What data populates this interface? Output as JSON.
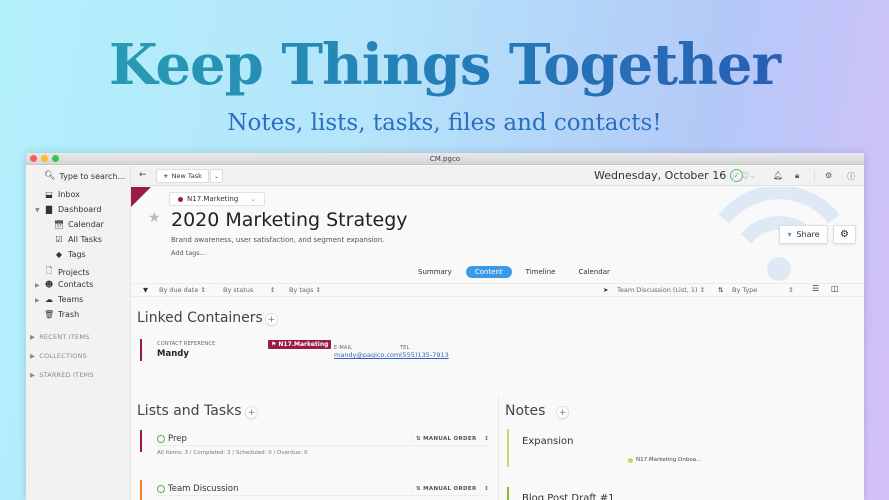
{
  "hero": {
    "title": "Keep Things Together",
    "subtitle": "Notes, lists, tasks, files and contacts!"
  },
  "window": {
    "title": "CM.pgco"
  },
  "sidebar": {
    "search_placeholder": "Type to search...",
    "items": [
      {
        "label": "Inbox",
        "icon": "inbox-icon"
      },
      {
        "label": "Dashboard",
        "icon": "chart-icon"
      },
      {
        "label": "Calendar",
        "icon": "calendar-icon"
      },
      {
        "label": "All Tasks",
        "icon": "checkbox-icon"
      },
      {
        "label": "Tags",
        "icon": "tags-icon"
      },
      {
        "label": "Projects",
        "icon": "document-icon"
      },
      {
        "label": "Contacts",
        "icon": "person-icon"
      },
      {
        "label": "Teams",
        "icon": "cloud-icon"
      },
      {
        "label": "Trash",
        "icon": "trash-icon"
      }
    ],
    "sections": [
      "RECENT ITEMS",
      "COLLECTIONS",
      "STARRED ITEMS"
    ]
  },
  "toolbar": {
    "back": "←",
    "new_task_label": "New Task",
    "date": "Wednesday, October 16"
  },
  "page": {
    "container": "N17.Marketing",
    "container_color": "#9a1b46",
    "title": "2020 Marketing Strategy",
    "description": "Brand awareness, user satisfaction, and segment expansion.",
    "add_tags": "Add tags...",
    "share_label": "Share",
    "tabs": [
      {
        "label": "Summary",
        "active": false
      },
      {
        "label": "Content",
        "active": true
      },
      {
        "label": "Timeline",
        "active": false
      },
      {
        "label": "Calendar",
        "active": false
      }
    ],
    "filters": {
      "due_date": "By due date",
      "status": "By status",
      "tags": "By tags",
      "location": "Team Discussion (List, 1)",
      "sort": "By Type"
    }
  },
  "linked_containers": {
    "title": "Linked Containers",
    "contact": {
      "ref_label": "CONTACT REFERENCE",
      "name": "Mandy",
      "badge": "N17.Marketing",
      "email_label": "E-MAIL",
      "email": "mandy@pagico.com",
      "tel_label": "TEL",
      "tel": "(555)135-7913"
    }
  },
  "lists": {
    "title": "Lists and Tasks",
    "items": [
      {
        "name": "Prep",
        "order": "MANUAL ORDER",
        "stats": "All Items: 3 / Completed: 3 / Scheduled: 0 / Overdue: 0",
        "color": "#9a1b46"
      },
      {
        "name": "Team Discussion",
        "order": "MANUAL ORDER",
        "stats": "",
        "color": "#f07c2a"
      }
    ]
  },
  "notes": {
    "title": "Notes",
    "items": [
      {
        "title": "Expansion",
        "tag": "N17.Marketing.Onboa...",
        "color": "#c9d66a"
      },
      {
        "title": "Blog Post Draft #1",
        "tag": "",
        "color": "#8ab832"
      }
    ]
  }
}
